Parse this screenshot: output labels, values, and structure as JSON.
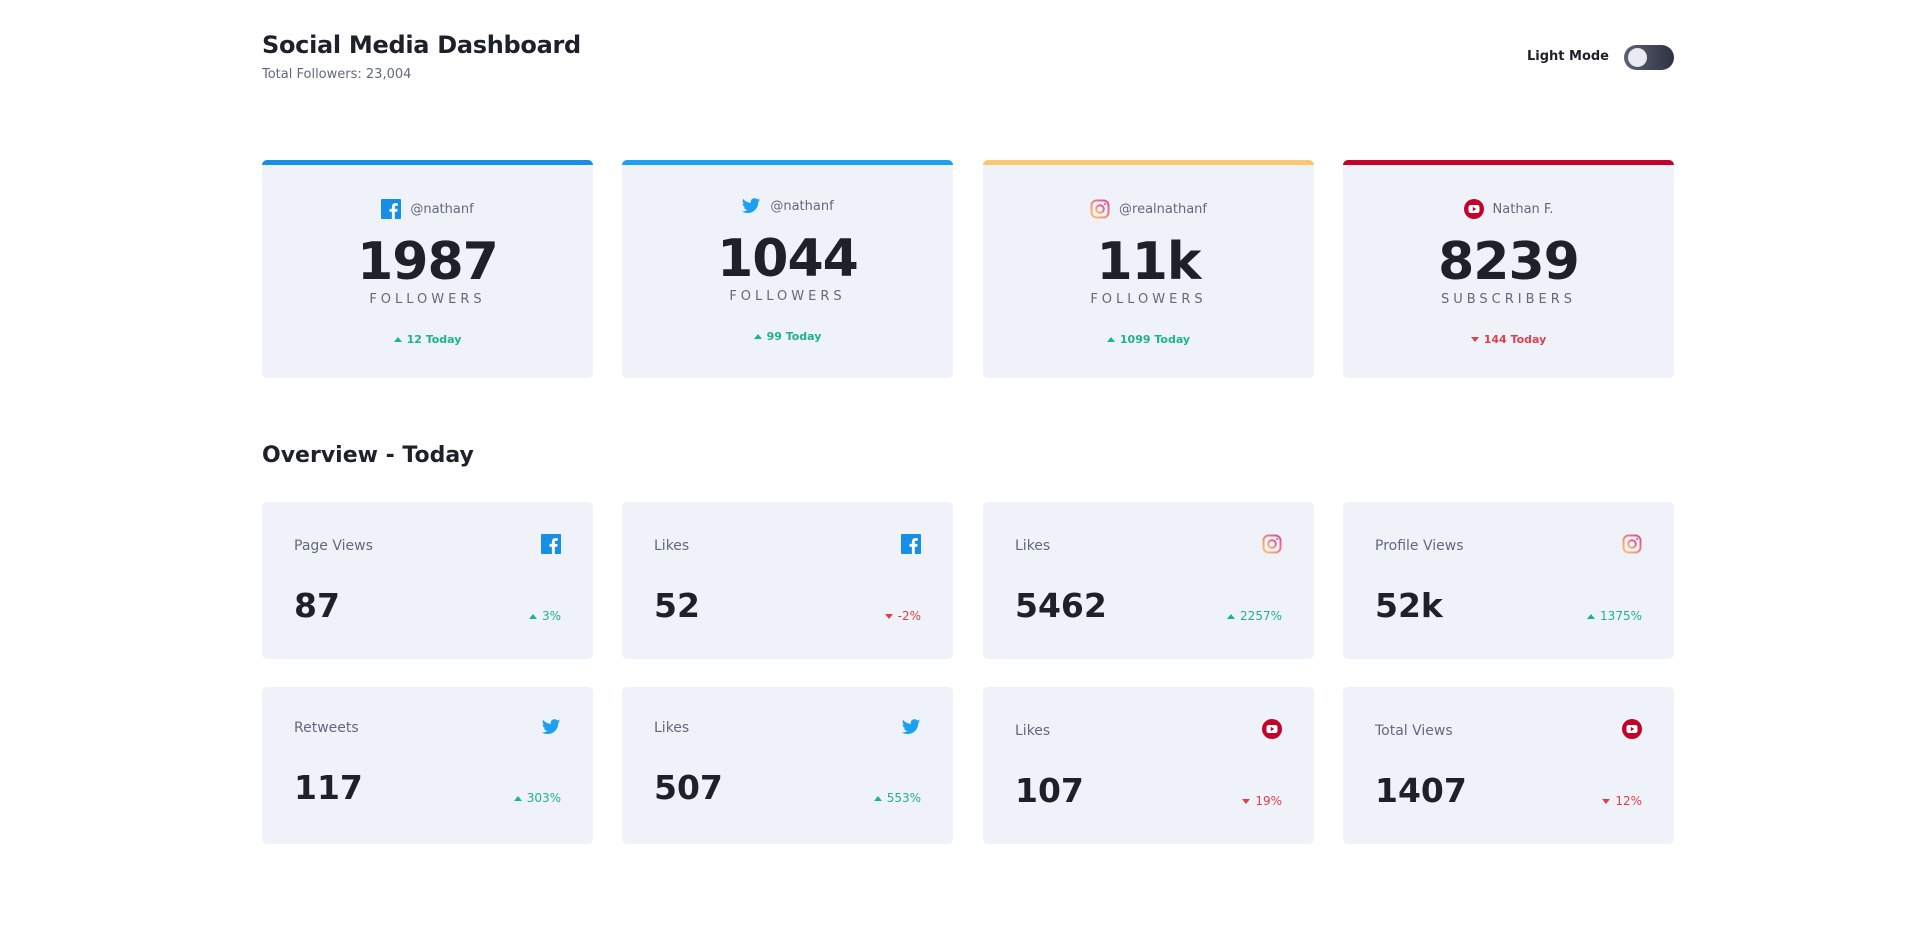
{
  "header": {
    "title": "Social Media Dashboard",
    "total_followers": "Total Followers: 23,004",
    "mode_label": "Light Mode"
  },
  "colors": {
    "facebook": "#178fe6",
    "twitter": "#1ca0f2",
    "instagram": "#f9c870",
    "youtube": "#c4032a",
    "up": "#1db489",
    "down": "#dc414c"
  },
  "follower_cards": [
    {
      "platform": "facebook",
      "icon": "facebook-icon",
      "handle": "@nathanf",
      "count": "1987",
      "unit": "FOLLOWERS",
      "delta": "12 Today",
      "direction": "up"
    },
    {
      "platform": "twitter",
      "icon": "twitter-icon",
      "handle": "@nathanf",
      "count": "1044",
      "unit": "FOLLOWERS",
      "delta": "99 Today",
      "direction": "up"
    },
    {
      "platform": "instagram",
      "icon": "instagram-icon",
      "handle": "@realnathanf",
      "count": "11k",
      "unit": "FOLLOWERS",
      "delta": "1099 Today",
      "direction": "up"
    },
    {
      "platform": "youtube",
      "icon": "youtube-icon",
      "handle": "Nathan F.",
      "count": "8239",
      "unit": "SUBSCRIBERS",
      "delta": "144 Today",
      "direction": "down"
    }
  ],
  "overview": {
    "title": "Overview - Today",
    "cards": [
      {
        "label": "Page Views",
        "icon": "facebook-icon",
        "value": "87",
        "delta": "3%",
        "direction": "up"
      },
      {
        "label": "Likes",
        "icon": "facebook-icon",
        "value": "52",
        "delta": "-2%",
        "direction": "down"
      },
      {
        "label": "Likes",
        "icon": "instagram-icon",
        "value": "5462",
        "delta": "2257%",
        "direction": "up"
      },
      {
        "label": "Profile Views",
        "icon": "instagram-icon",
        "value": "52k",
        "delta": "1375%",
        "direction": "up"
      },
      {
        "label": "Retweets",
        "icon": "twitter-icon",
        "value": "117",
        "delta": "303%",
        "direction": "up"
      },
      {
        "label": "Likes",
        "icon": "twitter-icon",
        "value": "507",
        "delta": "553%",
        "direction": "up"
      },
      {
        "label": "Likes",
        "icon": "youtube-icon",
        "value": "107",
        "delta": "19%",
        "direction": "down"
      },
      {
        "label": "Total Views",
        "icon": "youtube-icon",
        "value": "1407",
        "delta": "12%",
        "direction": "down"
      }
    ]
  }
}
